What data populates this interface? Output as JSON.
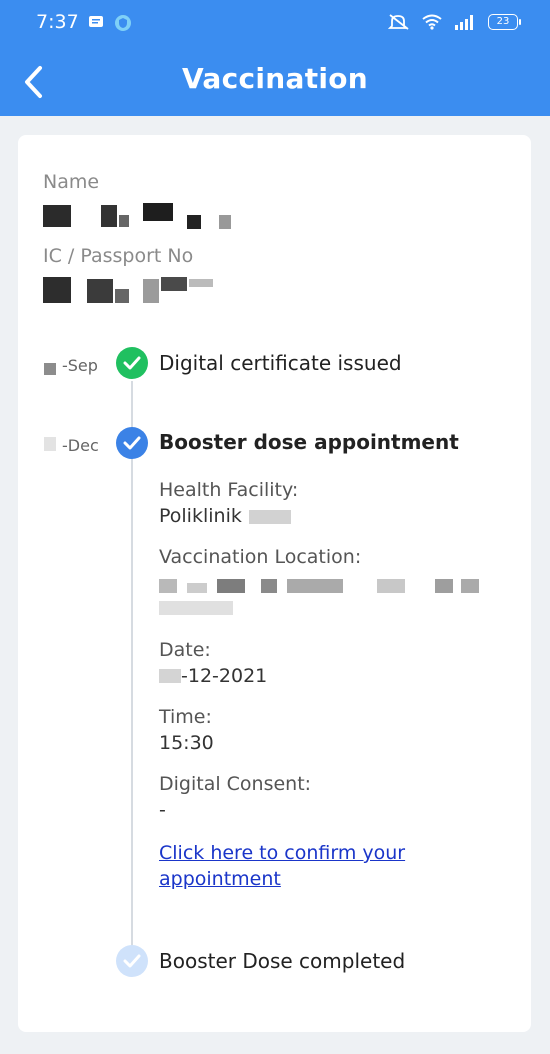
{
  "status_bar": {
    "time": "7:37",
    "battery": "23"
  },
  "header": {
    "title": "Vaccination"
  },
  "profile": {
    "name_label": "Name",
    "id_label": "IC / Passport No"
  },
  "timeline": [
    {
      "date": "-Sep",
      "title": "Digital certificate issued",
      "status": "done",
      "color": "#20c060"
    },
    {
      "date": "-Dec",
      "title": "Booster dose appointment",
      "status": "active",
      "color": "#3b82e6"
    },
    {
      "date": "",
      "title": "Booster Dose completed",
      "status": "pending",
      "color": "#cfe2fb"
    }
  ],
  "appointment": {
    "facility_label": "Health Facility:",
    "facility_value": "Poliklinik",
    "location_label": "Vaccination Location:",
    "date_label": "Date:",
    "date_value": "-12-2021",
    "time_label": "Time:",
    "time_value": "15:30",
    "consent_label": "Digital Consent:",
    "consent_value": "-",
    "confirm_link": "Click here to confirm your appointment"
  }
}
